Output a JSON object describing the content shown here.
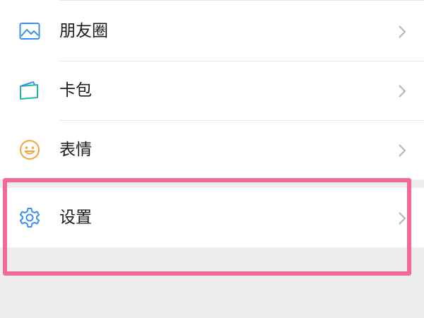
{
  "menu": {
    "items": [
      {
        "label": "朋友圈",
        "icon": "moments-image-icon"
      },
      {
        "label": "卡包",
        "icon": "card-wallet-icon"
      },
      {
        "label": "表情",
        "icon": "sticker-smiley-icon"
      },
      {
        "label": "设置",
        "icon": "settings-gear-icon"
      }
    ]
  },
  "colors": {
    "highlight": "#f06a93",
    "icon_blue": "#3d8ef2",
    "icon_green": "#1fb7a4",
    "icon_orange": "#f4a340",
    "background": "#ededed"
  }
}
